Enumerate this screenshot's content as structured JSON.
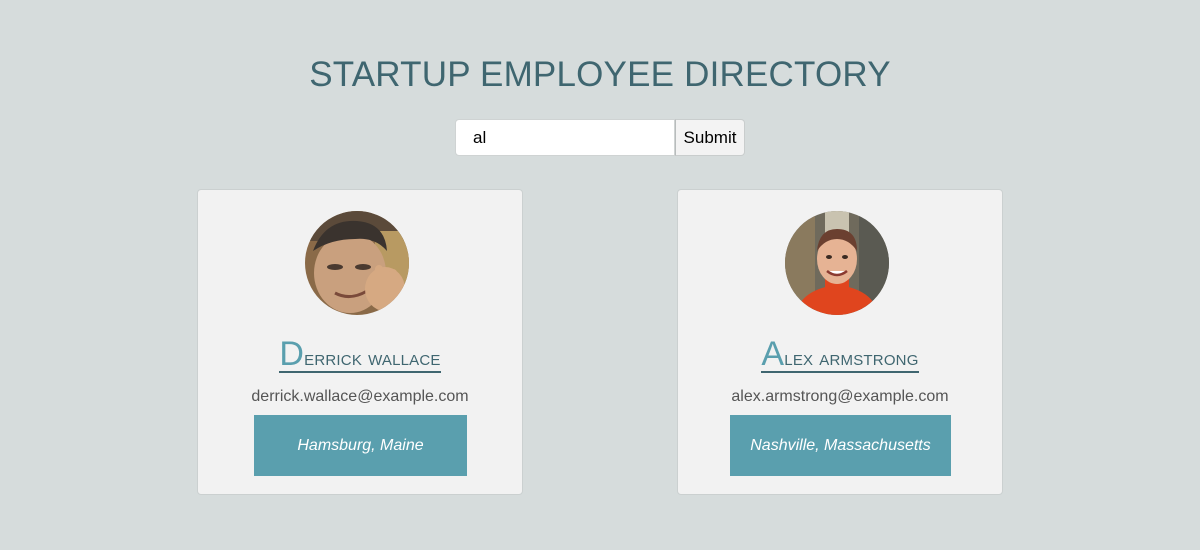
{
  "page": {
    "title": "STARTUP EMPLOYEE DIRECTORY"
  },
  "search": {
    "value": "al",
    "submit_label": "Submit"
  },
  "employees": [
    {
      "name": "Derrick wallace",
      "email": "derrick.wallace@example.com",
      "location": "Hamsburg, Maine",
      "avatar_icon": "avatar-photo-man-waving"
    },
    {
      "name": "Alex armstrong",
      "email": "alex.armstrong@example.com",
      "location": "Nashville, Massachusetts",
      "avatar_icon": "avatar-photo-man-orange-sweater"
    }
  ],
  "colors": {
    "background": "#d6dcdc",
    "title": "#3f6670",
    "accent": "#5a9fae",
    "card": "#f2f2f2"
  }
}
